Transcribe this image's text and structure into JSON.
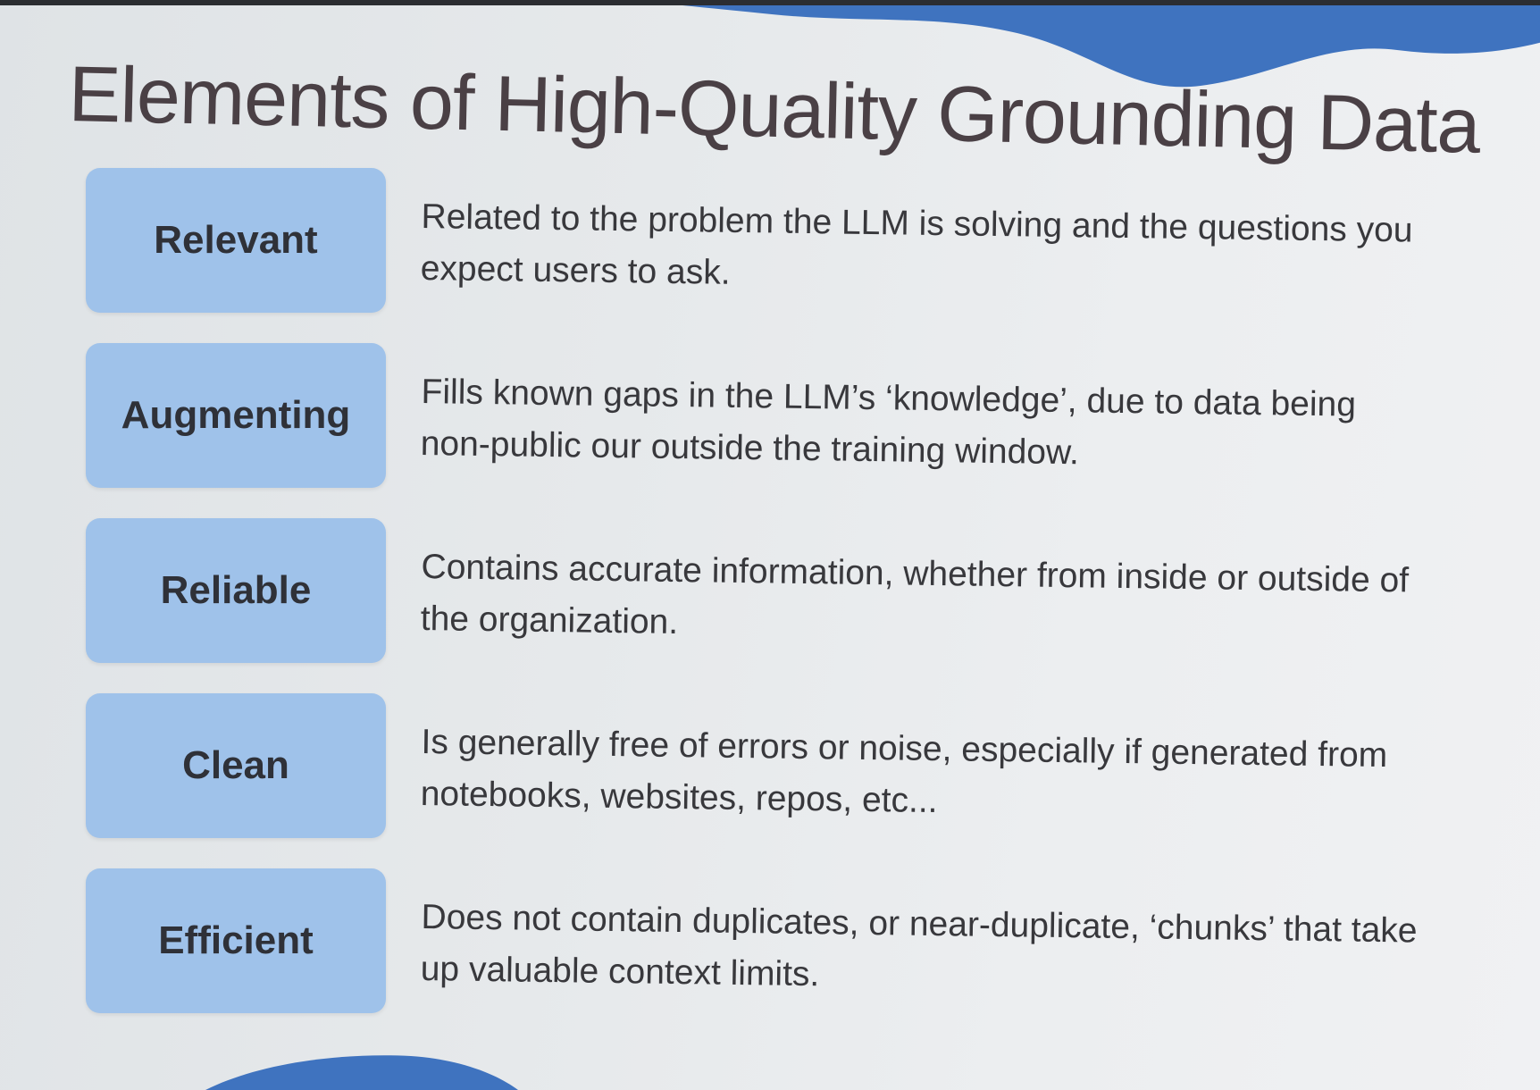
{
  "slide": {
    "title": "Elements of High-Quality Grounding Data",
    "colors": {
      "accent": "#3f73bf",
      "box": "#9fc2ea",
      "title": "#4a4045",
      "text": "#38383c"
    },
    "items": [
      {
        "label": "Relevant",
        "description": "Related to the problem the LLM is solving and the questions you expect users to ask."
      },
      {
        "label": "Augmenting",
        "description": "Fills known gaps in the LLM’s ‘knowledge’, due to data being non-public our outside the training window."
      },
      {
        "label": "Reliable",
        "description": "Contains accurate information, whether from inside or outside of the organization."
      },
      {
        "label": "Clean",
        "description": "Is generally free of errors or noise, especially if generated from notebooks, websites, repos, etc..."
      },
      {
        "label": "Efficient",
        "description": "Does not contain duplicates, or near-duplicate, ‘chunks’ that take up valuable context limits."
      }
    ]
  }
}
